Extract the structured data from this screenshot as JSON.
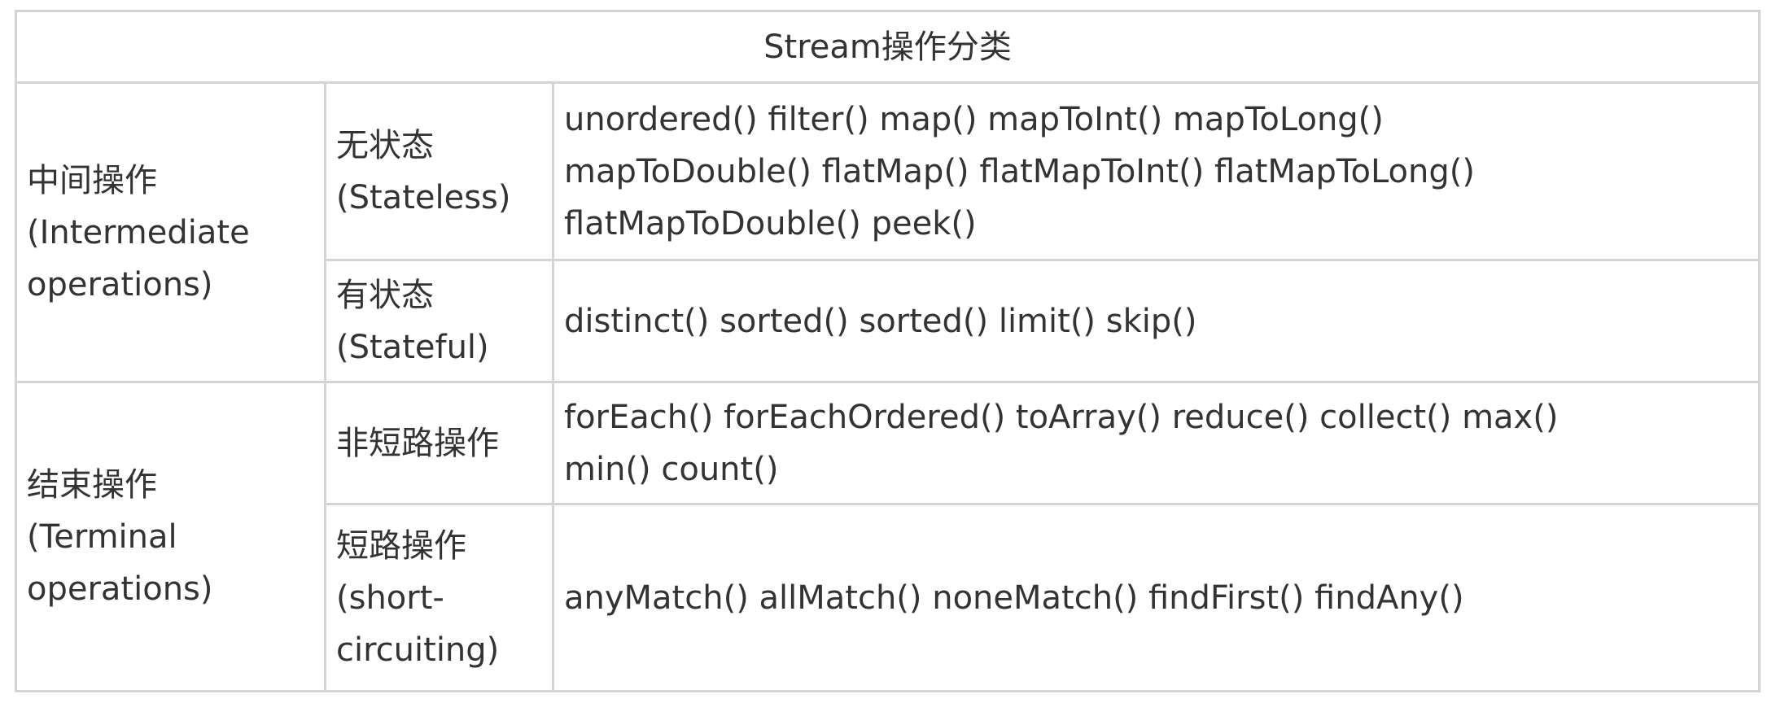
{
  "table": {
    "title": "Stream操作分类",
    "groups": [
      {
        "category_cn": "中间操作",
        "category_en_1": "(Intermediate",
        "category_en_2": "operations)",
        "rows": [
          {
            "sub_cn": "无状态",
            "sub_en": "(Stateless)",
            "ops_lines": [
              "unordered() filter() map() mapToInt() mapToLong()",
              "mapToDouble() flatMap() flatMapToInt() flatMapToLong()",
              "flatMapToDouble() peek()"
            ]
          },
          {
            "sub_cn": "有状态",
            "sub_en": "(Stateful)",
            "ops_lines": [
              "distinct() sorted() sorted() limit() skip()"
            ]
          }
        ]
      },
      {
        "category_cn": "结束操作",
        "category_en_1": "(Terminal",
        "category_en_2": "operations)",
        "rows": [
          {
            "sub_cn": "非短路操作",
            "ops_lines": [
              "forEach() forEachOrdered() toArray() reduce() collect() max()",
              "min() count()"
            ]
          },
          {
            "sub_cn": "短路操作",
            "sub_en_1": "(short-",
            "sub_en_2": "circuiting)",
            "ops_lines": [
              "anyMatch() allMatch() noneMatch() findFirst() findAny()"
            ]
          }
        ]
      }
    ]
  }
}
